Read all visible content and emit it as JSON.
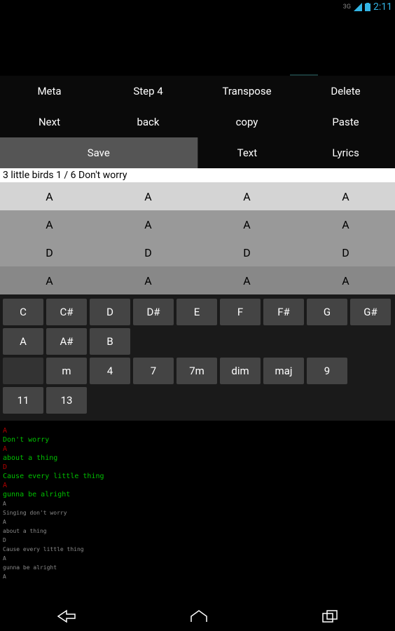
{
  "statusbar": {
    "network": "3G",
    "clock": "2:11"
  },
  "toolbar": {
    "row1": [
      "Meta",
      "Step 4",
      "Transpose",
      "Delete"
    ],
    "row2": [
      "Next",
      "back",
      "copy",
      "Paste"
    ],
    "row3": [
      "Save",
      "Text",
      "Lyrics"
    ]
  },
  "song_title": "3 little birds 1 / 6 Don't worry",
  "chord_rows": [
    [
      "A",
      "A",
      "A",
      "A"
    ],
    [
      "A",
      "A",
      "A",
      "A"
    ],
    [
      "D",
      "D",
      "D",
      "D"
    ],
    [
      "A",
      "A",
      "A",
      "A"
    ]
  ],
  "picker": {
    "notes1": [
      "C",
      "C#",
      "D",
      "D#",
      "E",
      "F",
      "F#",
      "G",
      "G#"
    ],
    "notes2": [
      "A",
      "A#",
      "B"
    ],
    "mods1": [
      "",
      "m",
      "4",
      "7",
      "7m",
      "dim",
      "maj",
      "9"
    ],
    "mods2": [
      "11",
      "13"
    ]
  },
  "lyrics": [
    {
      "t": "chord",
      "v": "A"
    },
    {
      "t": "lyric",
      "v": "Don't worry"
    },
    {
      "t": "chord",
      "v": "A"
    },
    {
      "t": "lyric",
      "v": "about a thing"
    },
    {
      "t": "chord",
      "v": "D"
    },
    {
      "t": "lyric",
      "v": "Cause every little thing"
    },
    {
      "t": "chord",
      "v": "A"
    },
    {
      "t": "lyric",
      "v": "gunna be alright"
    },
    {
      "t": "chord",
      "v": "A",
      "s": true
    },
    {
      "t": "lyric",
      "v": "Singing don't worry",
      "s": true
    },
    {
      "t": "chord",
      "v": "A",
      "s": true
    },
    {
      "t": "lyric",
      "v": "about a thing",
      "s": true
    },
    {
      "t": "chord",
      "v": "D",
      "s": true
    },
    {
      "t": "lyric",
      "v": "Cause every little thing",
      "s": true
    },
    {
      "t": "chord",
      "v": "A",
      "s": true
    },
    {
      "t": "lyric",
      "v": "gunna be alright",
      "s": true
    },
    {
      "t": "chord",
      "v": "A",
      "s": true
    }
  ]
}
